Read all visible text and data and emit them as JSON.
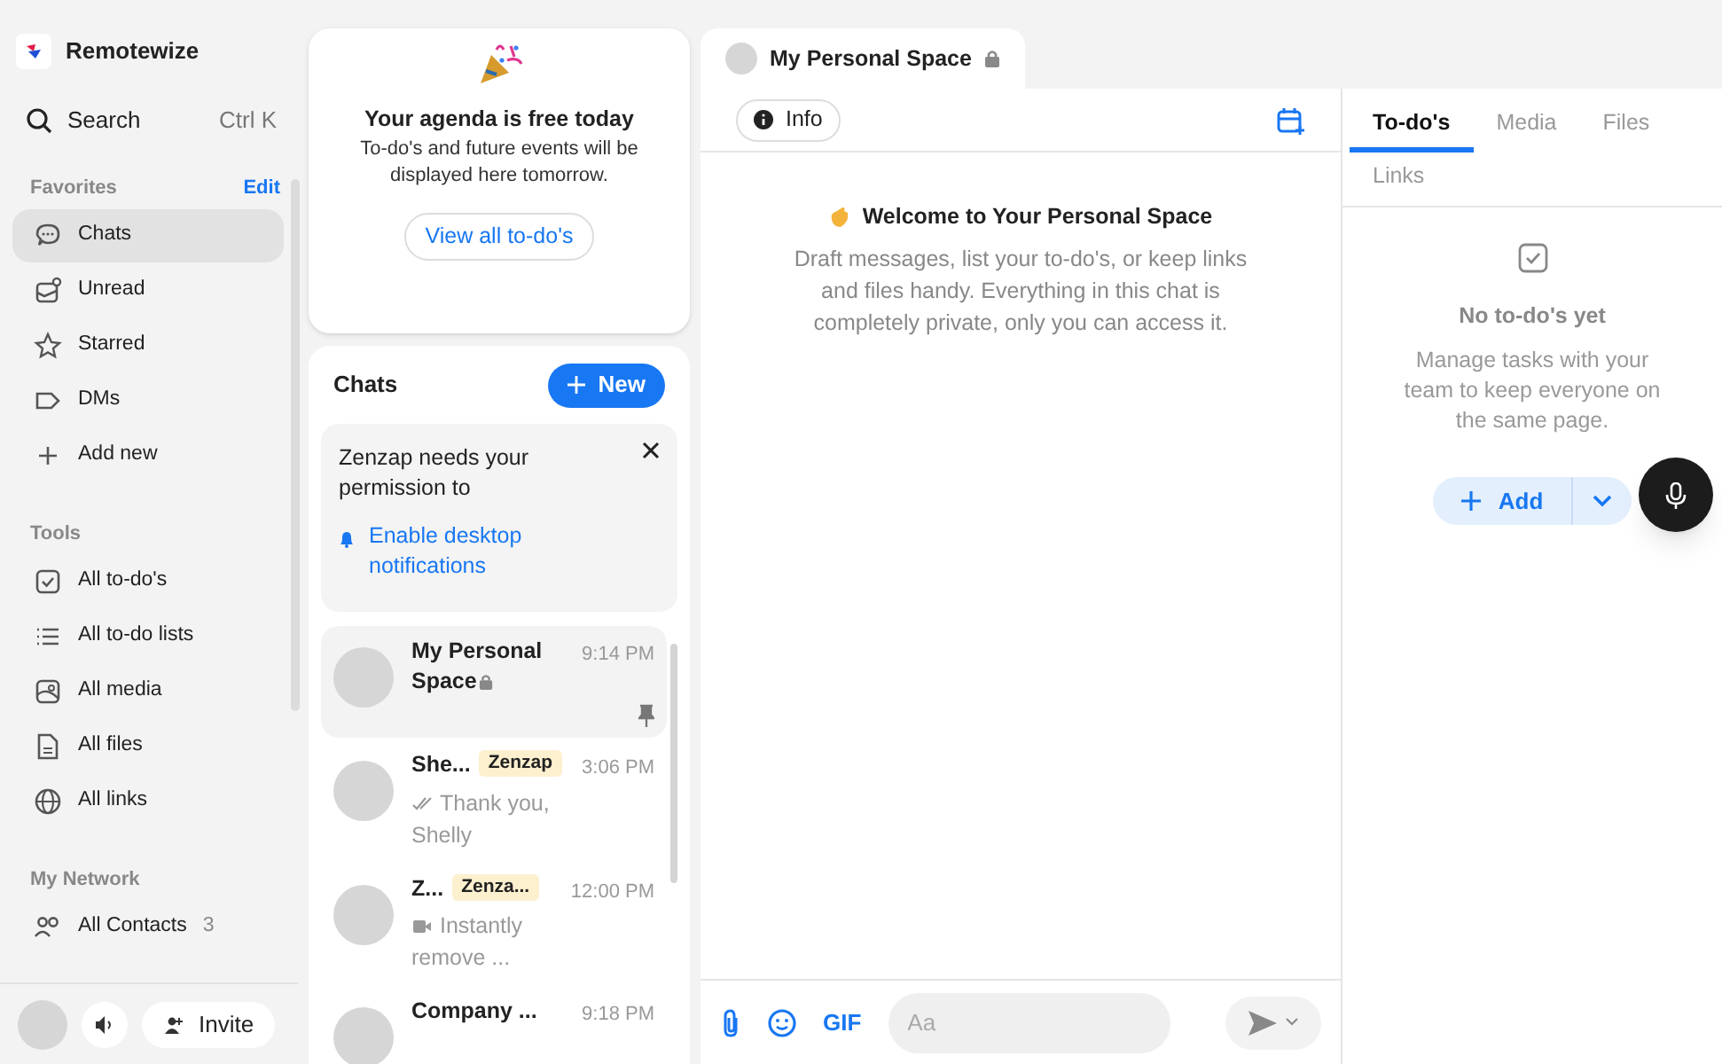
{
  "app": {
    "name": "Remotewize"
  },
  "search": {
    "label": "Search",
    "shortcut": "Ctrl K"
  },
  "sidebar": {
    "sections": [
      {
        "title": "Favorites",
        "action": "Edit",
        "items": [
          {
            "label": "Chats",
            "selected": true
          },
          {
            "label": "Unread",
            "selected": false
          },
          {
            "label": "Starred",
            "selected": false
          },
          {
            "label": "DMs",
            "selected": false
          },
          {
            "label": "Add new",
            "selected": false
          }
        ]
      },
      {
        "title": "Tools",
        "items": [
          {
            "label": "All to-do's",
            "selected": false
          },
          {
            "label": "All to-do lists",
            "selected": false
          },
          {
            "label": "All media",
            "selected": false
          },
          {
            "label": "All files",
            "selected": false
          },
          {
            "label": "All links",
            "selected": false
          }
        ]
      },
      {
        "title": "My Network",
        "items": [
          {
            "label": "All Contacts",
            "count": "3",
            "selected": false
          }
        ]
      }
    ]
  },
  "footer": {
    "invite": "Invite"
  },
  "agenda": {
    "title": "Your agenda is free today",
    "text": "To-do's and future events will be displayed here tomorrow.",
    "button": "View all to-do's"
  },
  "chats": {
    "title": "Chats",
    "new_button": "New",
    "notice": {
      "text": "Zenzap needs your permission to",
      "link": "Enable desktop notifications"
    },
    "items": [
      {
        "name": "My Personal Space",
        "locked": true,
        "time": "9:14 PM",
        "pinned": true,
        "selected": true
      },
      {
        "name": "She...",
        "locked": false,
        "badge": "Zenzap",
        "time": "3:06 PM",
        "preview": {
          "kind": "read",
          "text": "Thank you, Shelly"
        },
        "pinned": false,
        "selected": false
      },
      {
        "name": "Z...",
        "locked": false,
        "badge": "Zenza...",
        "time": "12:00 PM",
        "preview": {
          "kind": "video",
          "text": "Instantly remove ..."
        },
        "pinned": false,
        "selected": false
      },
      {
        "name": "Company ...",
        "locked": false,
        "time": "9:18 PM",
        "pinned": false,
        "selected": false
      }
    ]
  },
  "conversation": {
    "tab": "My Personal Space",
    "info_button": "Info",
    "welcome_title": "Welcome to Your Personal Space",
    "welcome_text": "Draft messages, list your to-do's, or keep links and files handy. Everything in this chat is completely private, only you can access it.",
    "gif": "GIF",
    "placeholder": "Aa"
  },
  "details": {
    "tabs": [
      {
        "label": "To-do's",
        "selected": true
      },
      {
        "label": "Media",
        "selected": false
      },
      {
        "label": "Files",
        "selected": false
      },
      {
        "label": "Links",
        "selected": false
      }
    ],
    "empty_title": "No to-do's yet",
    "empty_text": "Manage tasks with your team to keep everyone on the same page.",
    "add_button": "Add"
  }
}
